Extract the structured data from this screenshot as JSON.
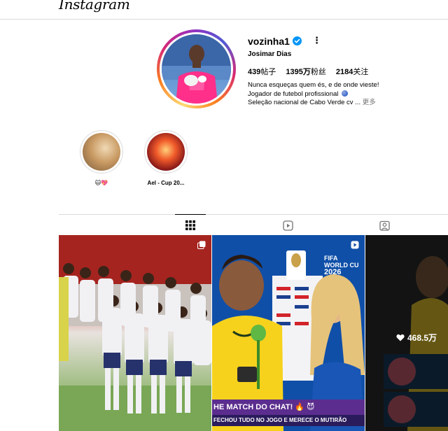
{
  "app": {
    "logo_text": "Instagram"
  },
  "profile": {
    "username": "vozinha1",
    "full_name": "Josimar Dias",
    "stats": [
      {
        "number": "439",
        "label": "帖子"
      },
      {
        "number": "1395万",
        "label": "粉丝"
      },
      {
        "number": "2184",
        "label": "关注"
      }
    ],
    "bio": {
      "line1": "Nunca esqueças quem és, e de onde vieste!",
      "line2": "Jogador de futebol profissional",
      "line3": "Seleção nacional de Cabo Verde cv ...",
      "more_label": "更多"
    }
  },
  "highlights": [
    {
      "label": "🐱💖"
    },
    {
      "label": "Ael - Cup 20..."
    }
  ],
  "tabs": [
    {
      "name": "posts",
      "icon": "grid-icon",
      "active": true
    },
    {
      "name": "reels",
      "icon": "reels-icon",
      "active": false
    },
    {
      "name": "tagged",
      "icon": "tagged-icon",
      "active": false
    }
  ],
  "posts": [
    {
      "type": "carousel",
      "icon": "carousel-icon"
    },
    {
      "type": "reel",
      "icon": "reel-icon",
      "fifa_line1": "FIFA",
      "fifa_line2": "WORLD CU",
      "fifa_year": "2026",
      "caption_top": "HE MATCH DO CHAT! 🔥 😈",
      "caption_bottom": "FECHOU TUDO NO JOGO E MERECE O MUTIRÃO"
    },
    {
      "type": "hover",
      "likes": "468.5万"
    }
  ],
  "colors": {
    "verified": "#0095f6",
    "border": "#dbdbdb",
    "muted": "#737373"
  }
}
